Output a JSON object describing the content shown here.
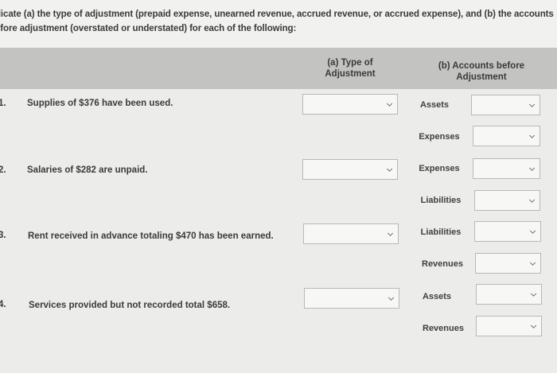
{
  "instructions": {
    "line1": "dicate (a) the type of adjustment (prepaid expense, unearned revenue, accrued revenue, or accrued expense), and (b) the accounts",
    "line2": "efore adjustment (overstated or understated) for each of the following:"
  },
  "columns": {
    "type_header_line1": "(a) Type of",
    "type_header_line2": "Adjustment",
    "accounts_header_line1": "(b) Accounts before",
    "accounts_header_line2": "Adjustment"
  },
  "rows": [
    {
      "num": "1.",
      "text": "Supplies of $376 have been used.",
      "accounts": [
        "Assets",
        "Expenses"
      ]
    },
    {
      "num": "2.",
      "text": "Salaries of $282 are unpaid.",
      "accounts": [
        "Expenses",
        "Liabilities"
      ]
    },
    {
      "num": "3.",
      "text": "Rent received in advance totaling $470 has been earned.",
      "accounts": [
        "Liabilities",
        "Revenues"
      ]
    },
    {
      "num": "4.",
      "text": "Services provided but not recorded total $658.",
      "accounts": [
        "Assets",
        "Revenues"
      ]
    }
  ],
  "icons": {
    "dropdown": "chevron-down-icon"
  }
}
